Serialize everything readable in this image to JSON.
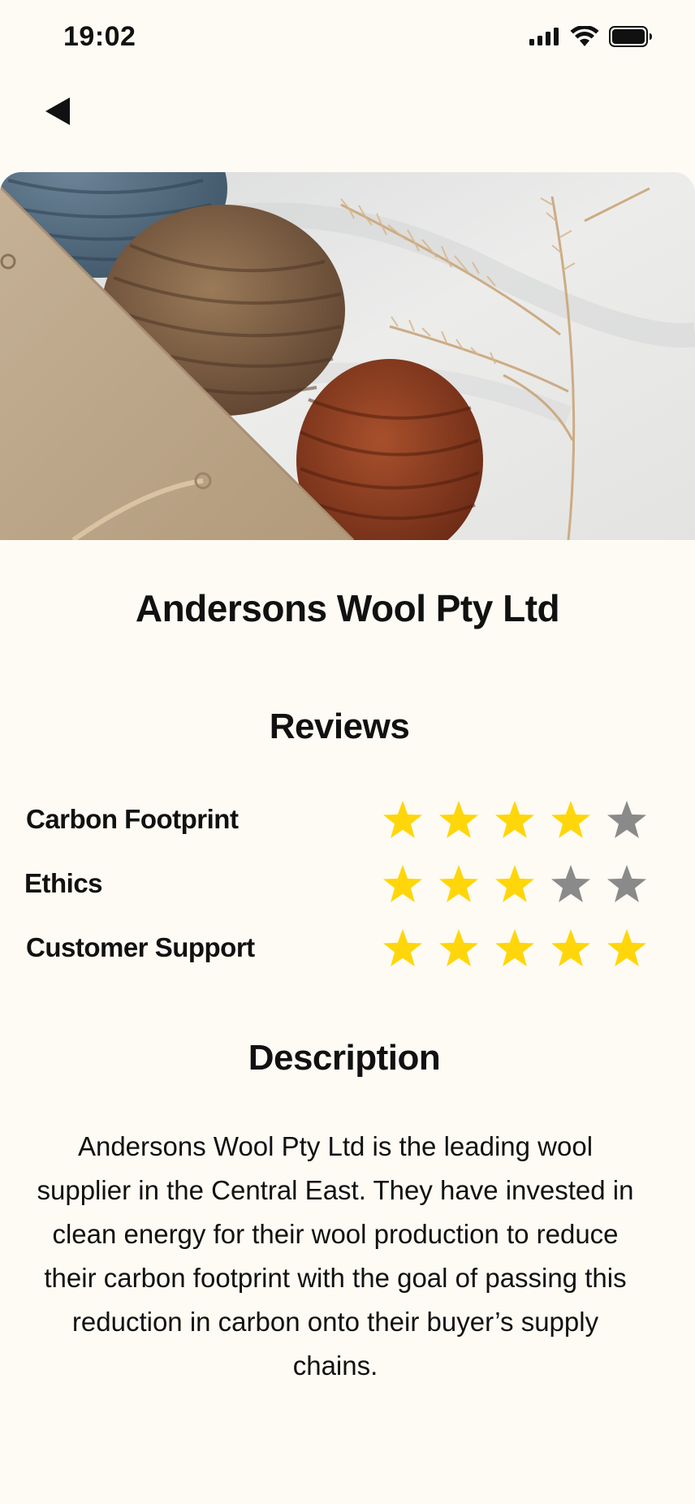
{
  "status_bar": {
    "time": "19:02",
    "icons": [
      "cellular-signal-icon",
      "wifi-icon",
      "battery-icon"
    ]
  },
  "navigation": {
    "back_icon": "back-arrow-icon"
  },
  "hero_image": {
    "alt": "Balls of blue, brown and rust coloured wool yarn beside a kraft paper bag and dried grass"
  },
  "company": {
    "name": "Andersons Wool Pty Ltd"
  },
  "reviews": {
    "title": "Reviews",
    "max_stars": 5,
    "items": [
      {
        "label": "Carbon Footprint",
        "rating": 4
      },
      {
        "label": "Ethics",
        "rating": 3
      },
      {
        "label": "Customer Support",
        "rating": 5
      }
    ]
  },
  "description": {
    "title": "Description",
    "text": "Andersons Wool Pty Ltd is the leading wool supplier in the Central East. They have invested in clean energy for their wool production to reduce their carbon footprint with the goal of passing this reduction in carbon onto their buyer’s supply chains."
  },
  "colors": {
    "background": "#fdfbf4",
    "star_filled": "#ffd60a",
    "star_empty": "#8a8a8a"
  }
}
